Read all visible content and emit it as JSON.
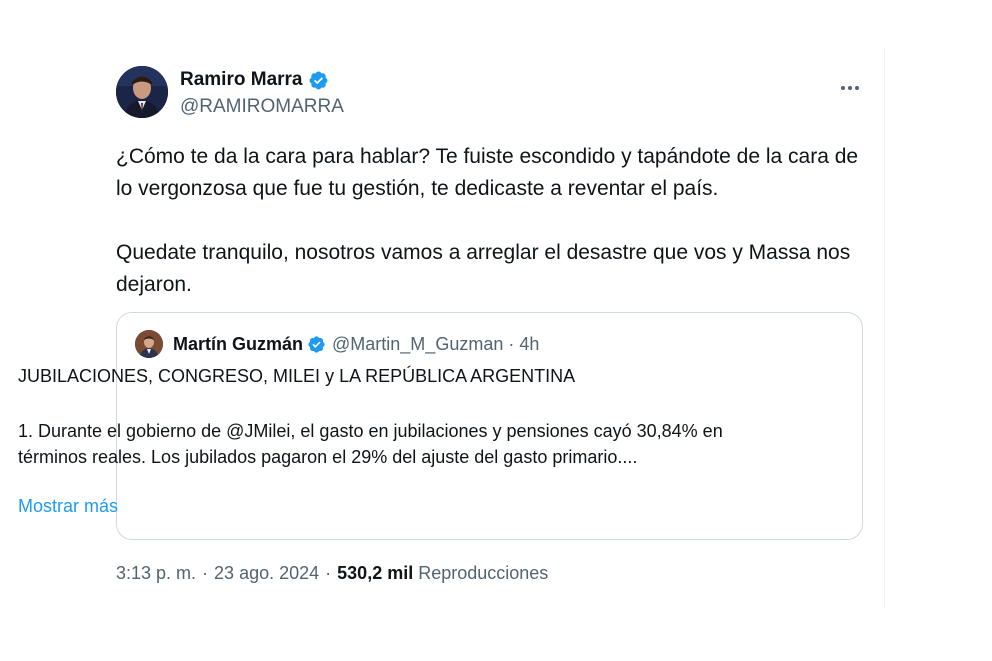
{
  "author": {
    "name": "Ramiro Marra",
    "handle": "@RAMIROMARRA",
    "verified": true
  },
  "tweet": {
    "paragraphs": [
      "¿Cómo te da la cara para hablar? Te fuiste escondido y tapándote de la cara de lo vergonzosa que fue tu gestión, te dedicaste a reventar el país.",
      "Quedate tranquilo, nosotros vamos a arreglar el desastre que vos y Massa nos dejaron."
    ]
  },
  "quote": {
    "name": "Martín Guzmán",
    "handle": "@Martin_M_Guzman",
    "separator": "·",
    "time": "4h",
    "title": "JUBILACIONES, CONGRESO, MILEI y LA REPÚBLICA ARGENTINA",
    "body": "1. Durante el gobierno de @JMilei, el gasto en jubilaciones y pensiones cayó 30,84% en términos reales. Los jubilados pagaron el 29% del ajuste del gasto primario....",
    "show_more": "Mostrar más"
  },
  "meta": {
    "time": "3:13 p. m.",
    "separator": "·",
    "date": "23 ago. 2024",
    "views_count": "530,2 mil",
    "views_label": "Reproducciones"
  },
  "icons": {
    "verified": "verified-badge-icon",
    "more": "more-horizontal-icon"
  },
  "colors": {
    "verified": "#1d9bf0",
    "link": "#1d9bf0",
    "secondary_text": "#536471",
    "primary_text": "#0f1419",
    "border": "#cfd9de"
  }
}
